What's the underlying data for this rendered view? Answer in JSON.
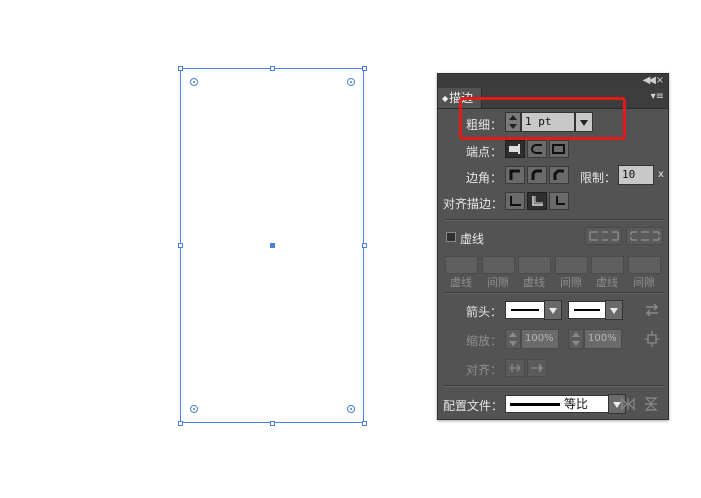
{
  "panel": {
    "title": "描边",
    "weight": {
      "label": "粗细：",
      "value": "1 pt"
    },
    "cap": {
      "label": "端点："
    },
    "corner": {
      "label": "边角：",
      "limit_label": "限制：",
      "limit_value": "10",
      "limit_unit": "x"
    },
    "align": {
      "label": "对齐描边："
    },
    "dashed": {
      "label": "虚线",
      "checked": false,
      "fields": [
        "虚线",
        "间隙",
        "虚线",
        "间隙",
        "虚线",
        "间隙"
      ]
    },
    "arrowheads": {
      "label": "箭头："
    },
    "scale": {
      "label": "缩放：",
      "start": "100%",
      "end": "100%"
    },
    "arrow_align": {
      "label": "对齐："
    },
    "profile": {
      "label": "配置文件：",
      "value": "等比"
    }
  },
  "colors": {
    "selection": "#4a7fdc",
    "panel_bg": "#535353",
    "highlight": "#e01b1b"
  }
}
